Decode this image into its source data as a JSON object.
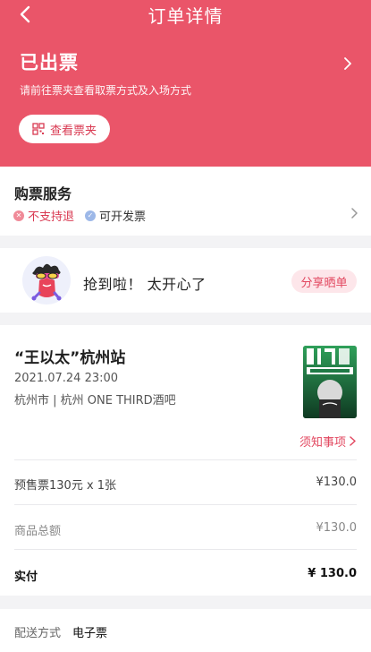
{
  "nav": {
    "title": "订单详情",
    "back_icon": "back-arrow-icon"
  },
  "status": {
    "title": "已出票",
    "subtitle": "请前往票夹查看取票方式及入场方式",
    "view_button": "查看票夹"
  },
  "services": {
    "title": "购票服务",
    "items": [
      {
        "label": "不支持退",
        "icon": "cross-circle-icon",
        "color": "#d93a52"
      },
      {
        "label": "可开发票",
        "icon": "check-circle-icon",
        "color": "#9db8e8"
      }
    ]
  },
  "share": {
    "text": "抢到啦！ 太开心了",
    "button": "分享晒单"
  },
  "order": {
    "event_title": "“王以太”杭州站",
    "datetime": "2021.07.24 23:00",
    "venue": "杭州市 | 杭州 ONE THIRD酒吧",
    "notice": "须知事项",
    "lines": [
      {
        "label": "预售票130元 x 1张",
        "value": "¥130.0"
      },
      {
        "label": "商品总额",
        "value": "¥130.0"
      },
      {
        "label": "实付",
        "value": "¥ 130.0"
      }
    ]
  },
  "delivery": {
    "label": "配送方式",
    "value": "电子票"
  },
  "colors": {
    "brand": "#ea5569",
    "accent": "#e2475f"
  }
}
